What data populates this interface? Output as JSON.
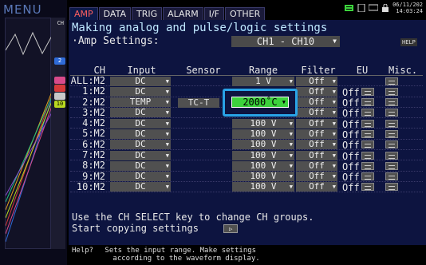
{
  "menu_label": "MENU",
  "left_panel": {
    "ch_tag": "CH",
    "markers": [
      {
        "label": "2",
        "color": "#2f6bd8"
      },
      {
        "label": "",
        "color": "#d84a8a"
      },
      {
        "label": "",
        "color": "#d63a3a"
      },
      {
        "label": "",
        "color": "#c8c8c8"
      },
      {
        "label": "10",
        "color": "#b8d820"
      }
    ]
  },
  "tabs": [
    {
      "label": "AMP",
      "active": true
    },
    {
      "label": "DATA",
      "active": false
    },
    {
      "label": "TRIG",
      "active": false
    },
    {
      "label": "ALARM",
      "active": false
    },
    {
      "label": "I/F",
      "active": false
    },
    {
      "label": "OTHER",
      "active": false
    }
  ],
  "status": {
    "date": "06/11/202",
    "time": "14:03:24"
  },
  "heading": "Making analog and pulse/logic settings",
  "amp_settings_label": "·Amp Settings:",
  "amp_range_select": "CH1 - CH10",
  "help_button": "HELP",
  "columns": [
    "CH",
    "Input",
    "Sensor",
    "Range",
    "Filter",
    "EU",
    "Misc."
  ],
  "rows": [
    {
      "ch": "ALL:M2",
      "input": "DC",
      "sensor": "",
      "range": "1 V",
      "filter": "Off",
      "eu": ""
    },
    {
      "ch": "1:M2",
      "input": "DC",
      "sensor": "",
      "range": "",
      "filter": "Off",
      "eu": "Off"
    },
    {
      "ch": "2:M2",
      "input": "TEMP",
      "sensor": "TC-T",
      "range": "",
      "filter": "Off",
      "eu": "Off"
    },
    {
      "ch": "3:M2",
      "input": "DC",
      "sensor": "",
      "range": "",
      "filter": "Off",
      "eu": "Off"
    },
    {
      "ch": "4:M2",
      "input": "DC",
      "sensor": "",
      "range": "100 V",
      "filter": "Off",
      "eu": "Off"
    },
    {
      "ch": "5:M2",
      "input": "DC",
      "sensor": "",
      "range": "100 V",
      "filter": "Off",
      "eu": "Off"
    },
    {
      "ch": "6:M2",
      "input": "DC",
      "sensor": "",
      "range": "100 V",
      "filter": "Off",
      "eu": "Off"
    },
    {
      "ch": "7:M2",
      "input": "DC",
      "sensor": "",
      "range": "100 V",
      "filter": "Off",
      "eu": "Off"
    },
    {
      "ch": "8:M2",
      "input": "DC",
      "sensor": "",
      "range": "100 V",
      "filter": "Off",
      "eu": "Off"
    },
    {
      "ch": "9:M2",
      "input": "DC",
      "sensor": "",
      "range": "100 V",
      "filter": "Off",
      "eu": "Off"
    },
    {
      "ch": "10:M2",
      "input": "DC",
      "sensor": "",
      "range": "100 V",
      "filter": "Off",
      "eu": "Off"
    }
  ],
  "highlight_range": "2000˚C",
  "bottom_note_1": "Use the CH SELECT key to change CH groups.",
  "bottom_note_2": "Start copying settings",
  "copy_button_glyph": "▷",
  "help_label": "Help?",
  "help_text_1": "Sets the input range. Make settings",
  "help_text_2": "according to the waveform display."
}
